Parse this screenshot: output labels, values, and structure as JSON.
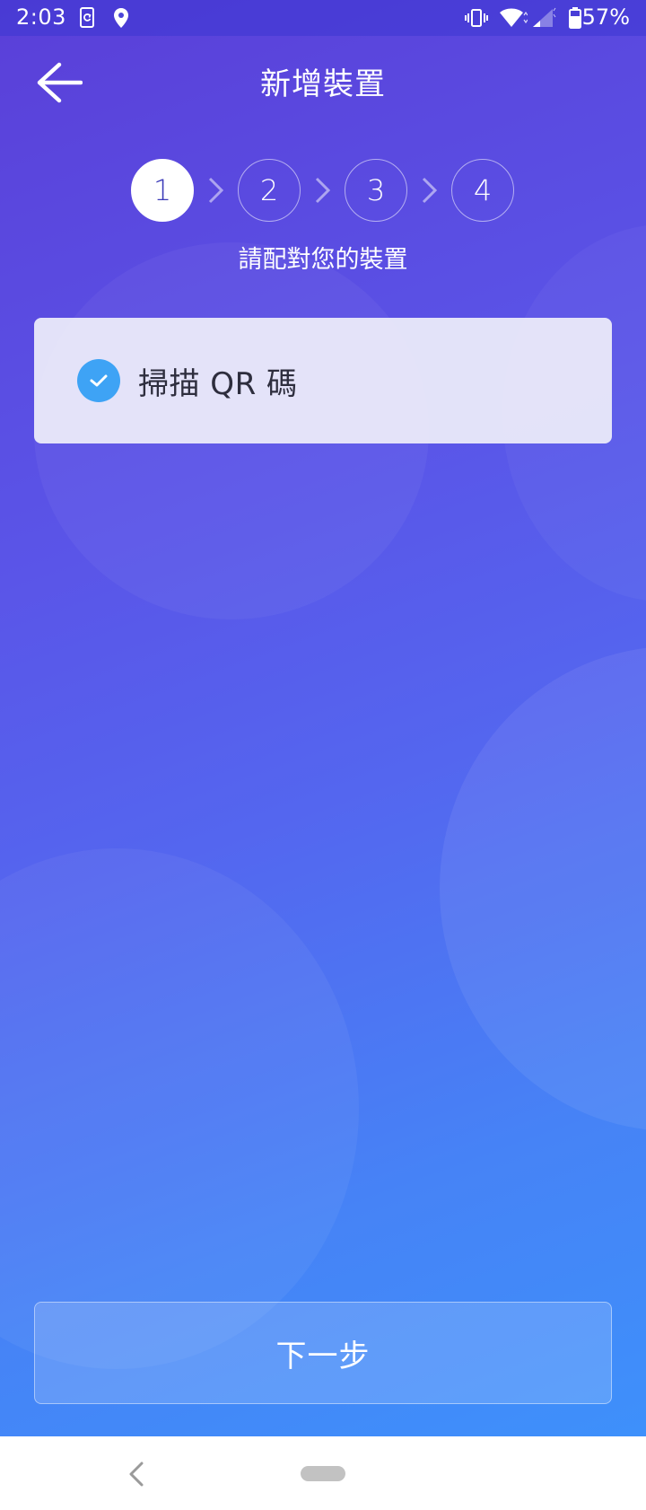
{
  "status_bar": {
    "time": "2:03",
    "battery_percent": "57%",
    "icons": [
      "sync-app-icon",
      "location-icon",
      "vibrate-icon",
      "wifi-icon",
      "cell-signal-icon",
      "battery-icon"
    ]
  },
  "header": {
    "title": "新增裝置",
    "back_icon": "arrow-left-icon"
  },
  "stepper": {
    "steps": [
      "1",
      "2",
      "3",
      "4"
    ],
    "active_step": 1,
    "caption": "請配對您的裝置"
  },
  "option": {
    "label": "掃描 QR 碼",
    "selected": true
  },
  "next_button": {
    "label": "下一步"
  },
  "nav_bar": {
    "back_icon": "nav-back-icon",
    "home_icon": "home-pill-icon"
  },
  "colors": {
    "gradient_top": "#5a3fd8",
    "gradient_bottom": "#3e90fb",
    "check_blue": "#3ea3f5",
    "card_bg": "#ececfa"
  }
}
